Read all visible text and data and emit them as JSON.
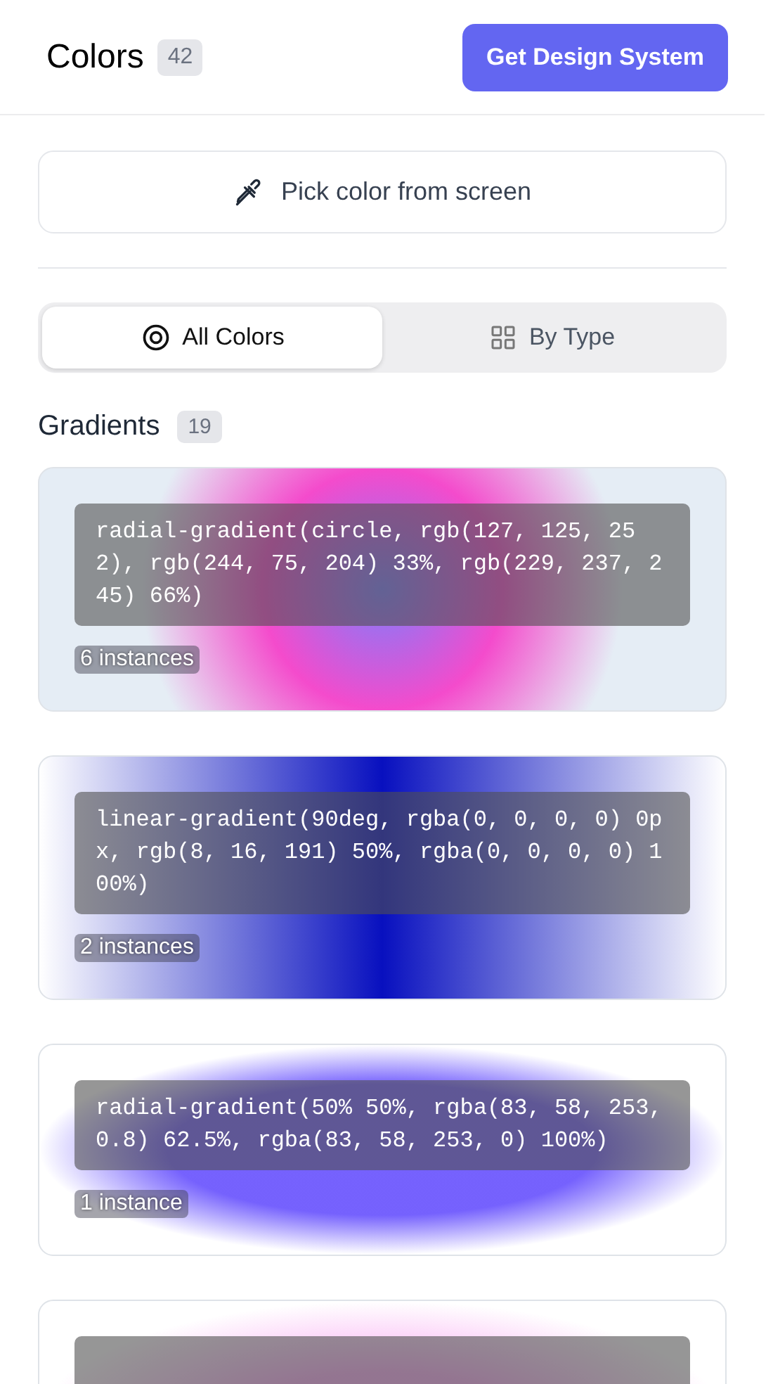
{
  "header": {
    "title": "Colors",
    "count": "42",
    "action": "Get Design System"
  },
  "pick_button": {
    "label": "Pick color from screen"
  },
  "tabs": [
    {
      "label": "All Colors",
      "kind": "target",
      "selected": true
    },
    {
      "label": "By Type",
      "kind": "grid",
      "selected": false
    }
  ],
  "section": {
    "title": "Gradients",
    "count": "19"
  },
  "gradients": [
    {
      "kind": "full",
      "code": "radial-gradient(circle, rgb(127, 125, 252), rgb(244, 75, 204) 33%, rgb(229, 237, 245) 66%)",
      "instances": "6 instances"
    },
    {
      "kind": "full",
      "code": "linear-gradient(90deg, rgba(0, 0, 0, 0) 0px, rgb(8, 16, 191) 50%, rgba(0, 0, 0, 0) 100%)",
      "instances": "2 instances"
    },
    {
      "kind": "full",
      "code": "radial-gradient(50% 50%, rgba(83, 58, 253, 0.8) 62.5%, rgba(83, 58, 253, 0) 100%)",
      "instances": "1 instance"
    },
    {
      "kind": "cut"
    }
  ]
}
